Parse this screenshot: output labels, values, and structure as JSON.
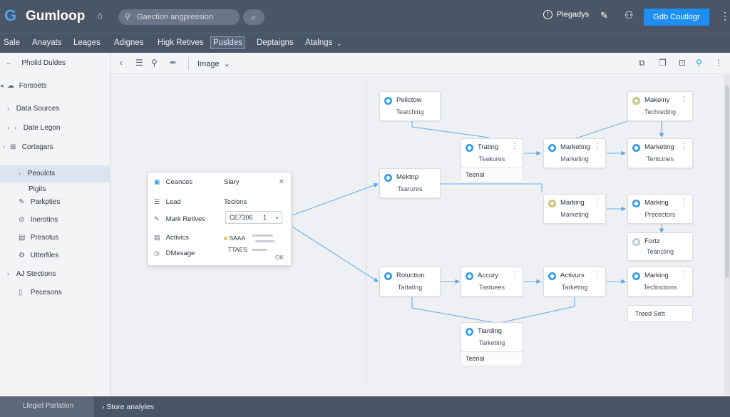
{
  "app": {
    "title": "Gumloop",
    "logo": "G"
  },
  "topbar": {
    "search_placeholder": "Gaection angpression",
    "help_label": "Piegadys",
    "primary_button": "Gdb Coutlogr",
    "colors": {
      "bar": "#4a5566",
      "accent": "#1e8ff0"
    }
  },
  "nav": {
    "items": [
      "Sale",
      "Anayats",
      "Leages",
      "Adignes",
      "Higk Retives",
      "Pusldes",
      "Deptaigns",
      "Atalngs"
    ],
    "active": "Pusldes"
  },
  "sidebar": {
    "header": "Pholid Duldes",
    "items": [
      "Forsoets",
      "Data Sources",
      "Date Legon",
      "Cortagars",
      "Peoulcts",
      "Pigits",
      "Parkpties",
      "Inerotins",
      "Presotus",
      "Utterfiles",
      "AJ Stections",
      "Pecesons"
    ],
    "selected": "Peoulcts"
  },
  "toolbar": {
    "view_label": "Image"
  },
  "panel": {
    "col1_header": "Ceances",
    "col2_header": "Slary",
    "rows": [
      "Lead",
      "Mark Retives",
      "Activics",
      "DMesage"
    ],
    "col2_value": "Teclons",
    "select_value": "CE7306",
    "select_number": "1",
    "tag_1": "SAAA",
    "tag_2": "TTAES",
    "ok_label": "OK"
  },
  "nodes": {
    "n1": {
      "title": "Pelictow",
      "sub": "Tearching"
    },
    "n2": {
      "title": "Trating",
      "sub": "Teakures"
    },
    "n2_footer": "Teenal",
    "n3": {
      "title": "Mektrip",
      "sub": "Tearures"
    },
    "n4": {
      "title": "Marketing",
      "sub": "Marketing"
    },
    "n5": {
      "title": "Makeiny",
      "sub": "Techreding"
    },
    "n6": {
      "title": "Marketing",
      "sub": "Tentcines"
    },
    "n7": {
      "title": "Marking",
      "sub": "Marketing"
    },
    "n8": {
      "title": "Marking",
      "sub": "Precectors"
    },
    "n9": {
      "title": "Fortz",
      "sub": "Teancling"
    },
    "n10": {
      "title": "Roluction",
      "sub": "Tartating"
    },
    "n11": {
      "title": "Accury",
      "sub": "Tastuees"
    },
    "n12": {
      "title": "Activurs",
      "sub": "Tarketing"
    },
    "n13": {
      "title": "Marking",
      "sub": "Tecfinctions"
    },
    "n14_label": "Treed Sett",
    "n15": {
      "title": "Tiarding",
      "sub": "Tarketing"
    },
    "n15_footer": "Teenal"
  },
  "bottombar": {
    "left": "Llegiel Parlation",
    "right": "Store analyles"
  }
}
